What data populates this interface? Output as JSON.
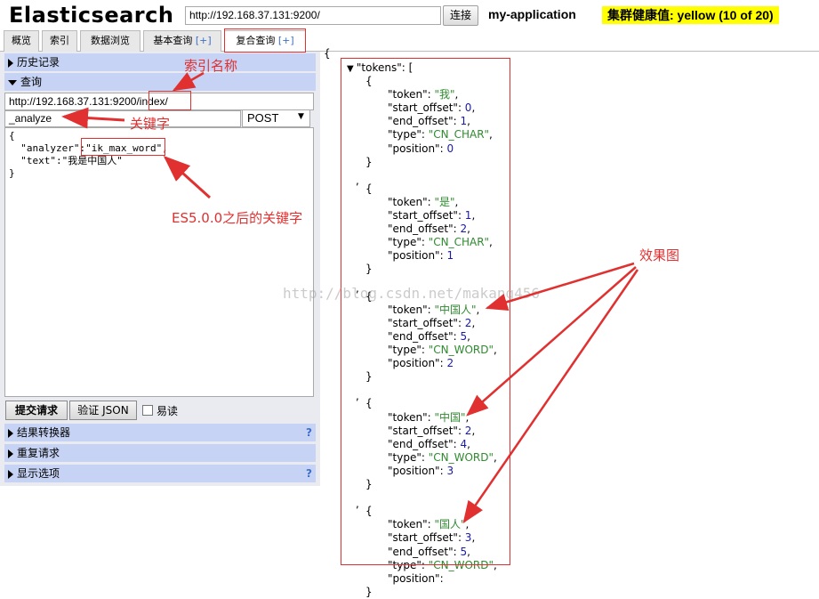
{
  "header": {
    "app_title": "Elasticsearch",
    "url": "http://192.168.37.131:9200/",
    "connect_label": "连接",
    "cluster_name": "my-application",
    "health": "集群健康值: yellow (10 of 20)"
  },
  "tabs": [
    {
      "label": "概览",
      "plus": ""
    },
    {
      "label": "索引",
      "plus": ""
    },
    {
      "label": "数据浏览",
      "plus": ""
    },
    {
      "label": "基本查询 ",
      "plus": "[+]"
    },
    {
      "label": "复合查询 ",
      "plus": "[+]"
    }
  ],
  "left": {
    "history_label": "历史记录",
    "query_label": "查询",
    "query_url_base": "http://192.168.37.131:9200",
    "query_url_index": "/index/",
    "path": "_analyze",
    "method": "POST",
    "method_arrow": "▼",
    "body_lines": [
      "{",
      "  \"analyzer\":",
      "\"ik_max_word\",",
      "  \"text\":\"我是中国人\"",
      "}"
    ],
    "submit_label": "提交请求",
    "validate_label": "验证 JSON",
    "readonly_label": "易读",
    "result_transformer_label": "结果转换器",
    "repeat_request_label": "重复请求",
    "display_options_label": "显示选项",
    "help_mark": "?"
  },
  "json": {
    "open_brace": "{",
    "tokens_key": "\"tokens\": [",
    "tokens": [
      {
        "token": "\"我\"",
        "start_offset": "0",
        "end_offset": "1",
        "type": "\"CN_CHAR\"",
        "position": "0"
      },
      {
        "token": "\"是\"",
        "start_offset": "1",
        "end_offset": "2",
        "type": "\"CN_CHAR\"",
        "position": "1"
      },
      {
        "token": "\"中国人\"",
        "start_offset": "2",
        "end_offset": "5",
        "type": "\"CN_WORD\"",
        "position": "2"
      },
      {
        "token": "\"中国\"",
        "start_offset": "2",
        "end_offset": "4",
        "type": "\"CN_WORD\"",
        "position": "3"
      },
      {
        "token": "\"国人\"",
        "start_offset": "3",
        "end_offset": "5",
        "type": "\"CN_WORD\"",
        "position": ""
      }
    ]
  },
  "annotations": {
    "index_name": "索引名称",
    "keyword": "关键字",
    "es5_keyword": "ES5.0.0之后的关键字",
    "effect": "效果图"
  },
  "watermark": "http://blog.csdn.net/makang456",
  "colors": {
    "annotation": "#e03030",
    "health_bg": "#ffff00",
    "section_bg": "#c6d3f5",
    "string": "#2e8b2e",
    "number": "#1a1aa6"
  }
}
